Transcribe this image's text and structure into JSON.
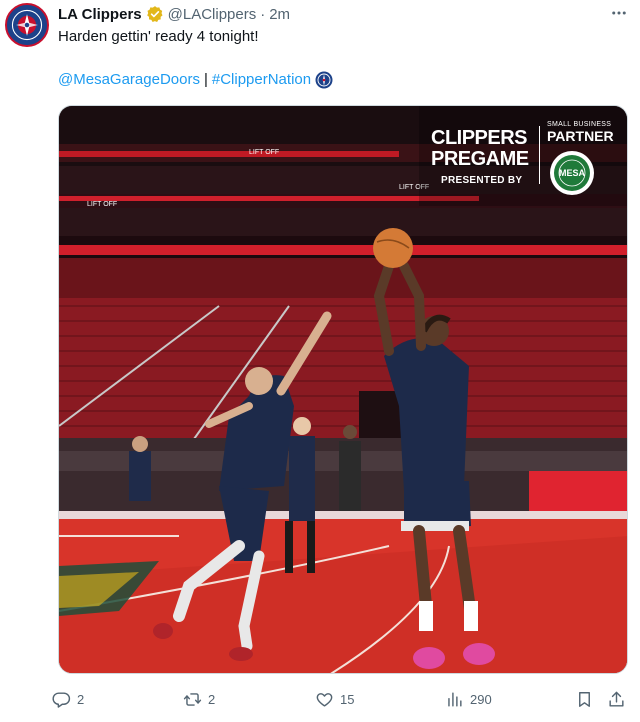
{
  "tweet": {
    "display_name": "LA Clippers",
    "handle": "@LAClippers",
    "separator": "·",
    "time": "2m",
    "text": "Harden gettin' ready 4 tonight!",
    "mention": "@MesaGarageDoors",
    "pipe": "|",
    "hashtag": "#ClipperNation",
    "hashtag_emoji": "clippers-compass-icon",
    "verified_icon": "verified-gold-icon",
    "more_icon": "more-horizontal-icon"
  },
  "media": {
    "overlay": {
      "title_line1": "CLIPPERS",
      "title_line2": "PREGAME",
      "presented_by": "PRESENTED BY",
      "small_business": "SMALL BUSINESS",
      "partner": "PARTNER",
      "partner_logo_text": "MESA"
    },
    "arena_signage": {
      "sign1": "LIFT OFF",
      "sign2": "LIFT OFF",
      "sign3": "LIFT OFF"
    }
  },
  "actions": {
    "reply_count": "2",
    "retweet_count": "2",
    "like_count": "15",
    "view_count": "290"
  },
  "colors": {
    "link": "#1d9bf0",
    "muted": "#536471",
    "court": "#d8342a",
    "seats": "#a8222c",
    "verified": "#e2b719"
  }
}
